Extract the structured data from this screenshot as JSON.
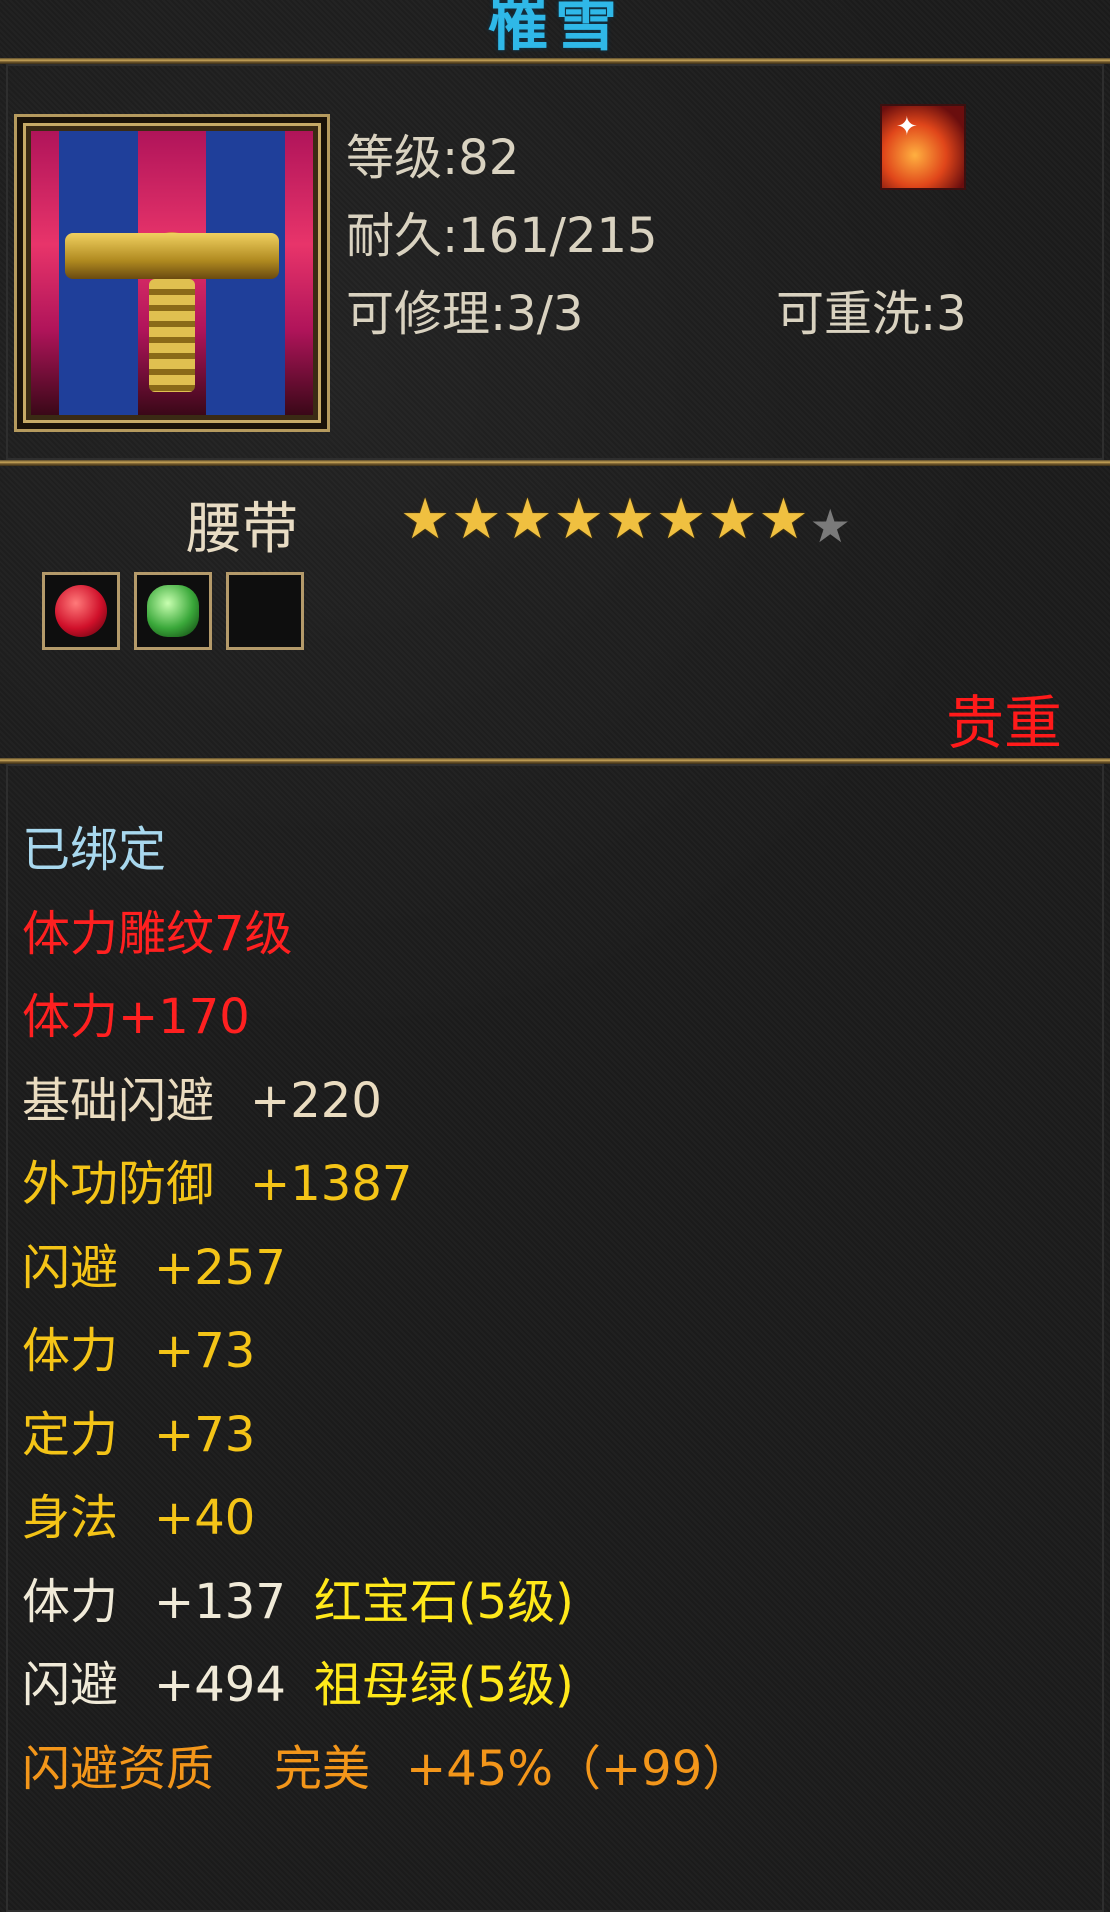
{
  "title": "罹雪",
  "item": {
    "level": "等级:82",
    "durability": "耐久:161/215",
    "repairable": "可修理:3/3",
    "rewashable": "可重洗:3",
    "type": "腰带",
    "stars_filled": 8,
    "stars_total": 9,
    "rarity": "贵重"
  },
  "attributes": {
    "bound": "已绑定",
    "engrave": "体力雕纹7级",
    "engrave_bonus": "体力+170",
    "base_dodge": "基础闪避",
    "base_dodge_val": "+220",
    "outer_def": "外功防御",
    "outer_def_val": "+1387",
    "dodge": "闪避",
    "dodge_val": "+257",
    "stamina": "体力",
    "stamina_val": "+73",
    "focus": "定力",
    "focus_val": "+73",
    "agility": "身法",
    "agility_val": "+40",
    "gem1_stat": "体力",
    "gem1_val": "+137",
    "gem1_name": "红宝石(5级)",
    "gem2_stat": "闪避",
    "gem2_val": "+494",
    "gem2_name": "祖母绿(5级)",
    "aptitude": "闪避资质",
    "aptitude_grade": "完美",
    "aptitude_val": "+45%（+99）"
  },
  "colors": {
    "title": "#2fb8e8",
    "rarity": "#ff1a1a",
    "bound": "#a8d8ee",
    "engrave": "#ff2020",
    "gold_stat": "#f4c417",
    "gem_name": "#ffe81a",
    "aptitude": "#f3961a"
  }
}
